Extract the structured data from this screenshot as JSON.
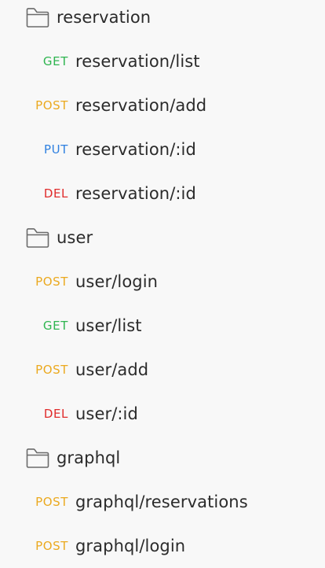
{
  "colors": {
    "GET": "#2fb550",
    "POST": "#eba91f",
    "PUT": "#2f80e0",
    "DEL": "#e02b2b"
  },
  "tree": [
    {
      "type": "folder",
      "name": "reservation",
      "icon": "folder-icon"
    },
    {
      "type": "request",
      "method": "GET",
      "path": "reservation/list"
    },
    {
      "type": "request",
      "method": "POST",
      "path": "reservation/add"
    },
    {
      "type": "request",
      "method": "PUT",
      "path": "reservation/:id"
    },
    {
      "type": "request",
      "method": "DEL",
      "path": "reservation/:id"
    },
    {
      "type": "folder",
      "name": "user",
      "icon": "folder-icon"
    },
    {
      "type": "request",
      "method": "POST",
      "path": "user/login"
    },
    {
      "type": "request",
      "method": "GET",
      "path": "user/list"
    },
    {
      "type": "request",
      "method": "POST",
      "path": "user/add"
    },
    {
      "type": "request",
      "method": "DEL",
      "path": "user/:id"
    },
    {
      "type": "folder",
      "name": "graphql",
      "icon": "folder-icon"
    },
    {
      "type": "request",
      "method": "POST",
      "path": "graphql/reservations"
    },
    {
      "type": "request",
      "method": "POST",
      "path": "graphql/login"
    }
  ]
}
